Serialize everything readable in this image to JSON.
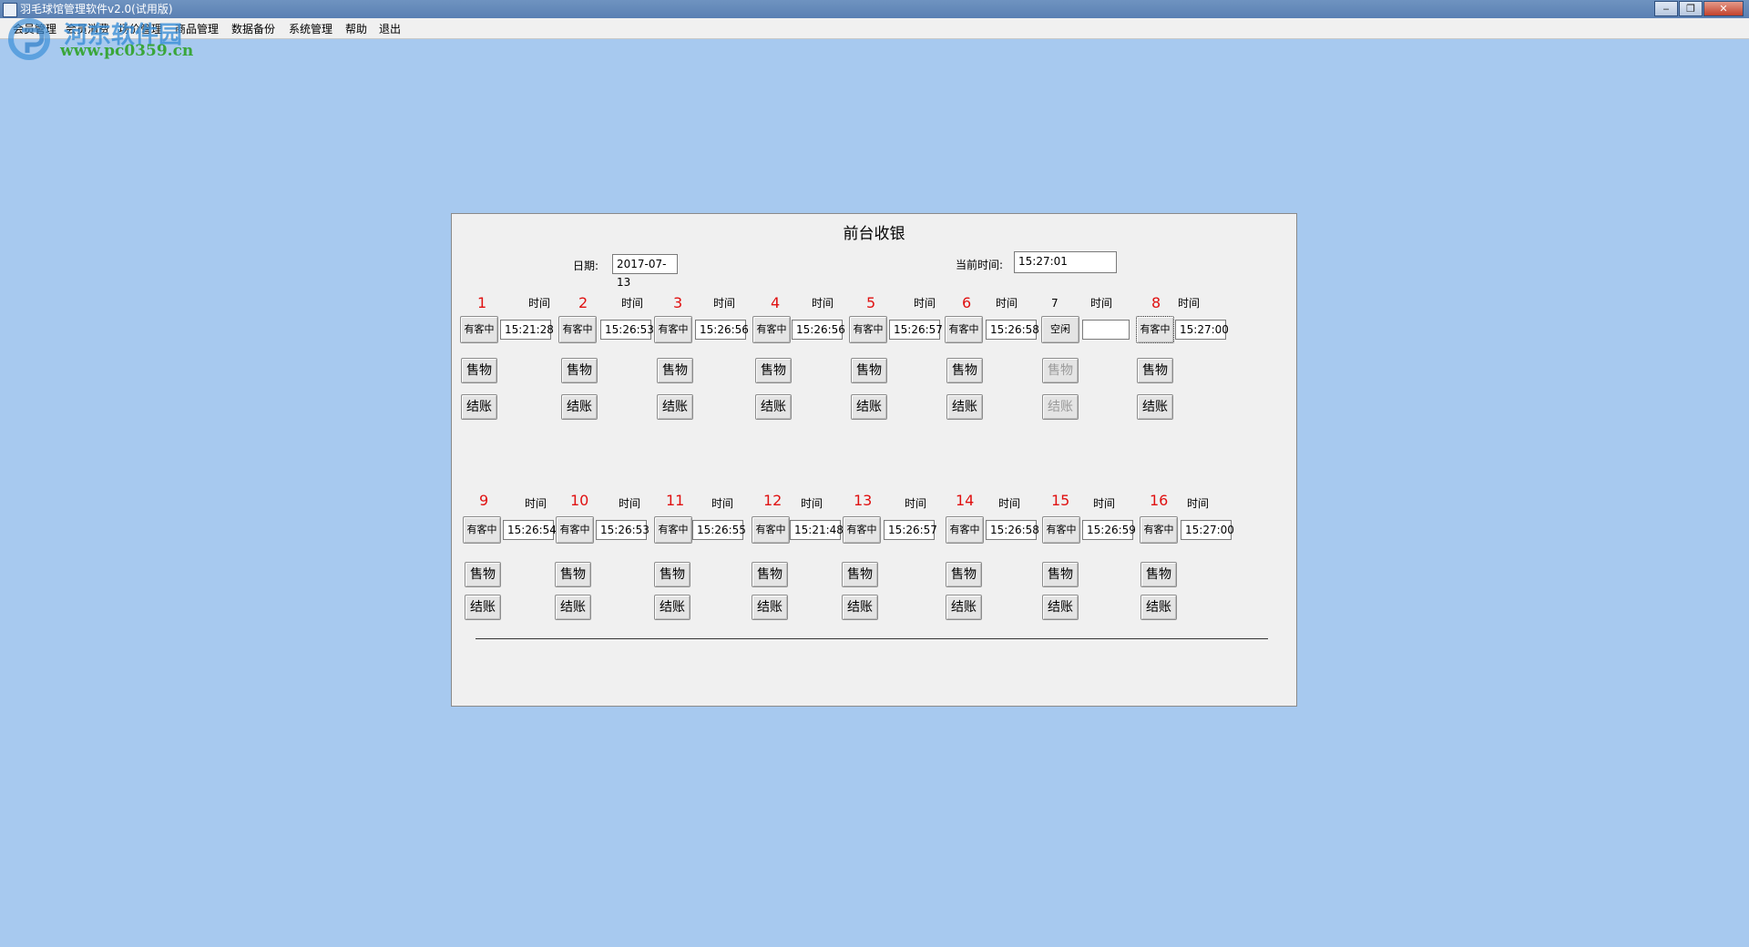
{
  "window": {
    "title": "羽毛球馆管理软件v2.0(试用版)",
    "controls": [
      "‒",
      "❐",
      "✕"
    ]
  },
  "menu": [
    "会员管理",
    "会员消费",
    "场价管理",
    "商品管理",
    "数据备份",
    "系统管理",
    "帮助",
    "退出"
  ],
  "watermark": {
    "site_name": "河东软件园",
    "url": "www.pc0359.cn"
  },
  "panel": {
    "title": "前台收银",
    "date_label": "日期:",
    "date_value": "2017-07-13",
    "current_time_label": "当前时间:",
    "current_time_value": "15:27:01",
    "time_label": "时间",
    "sell_label": "售物",
    "checkout_label": "结账"
  },
  "courts": [
    {
      "number": "1",
      "status": "有客中",
      "time": "15:21:28",
      "idle": false
    },
    {
      "number": "2",
      "status": "有客中",
      "time": "15:26:53",
      "idle": false
    },
    {
      "number": "3",
      "status": "有客中",
      "time": "15:26:56",
      "idle": false
    },
    {
      "number": "4",
      "status": "有客中",
      "time": "15:26:56",
      "idle": false
    },
    {
      "number": "5",
      "status": "有客中",
      "time": "15:26:57",
      "idle": false
    },
    {
      "number": "6",
      "status": "有客中",
      "time": "15:26:58",
      "idle": false
    },
    {
      "number": "7",
      "status": "空闲",
      "time": "",
      "idle": true
    },
    {
      "number": "8",
      "status": "有客中",
      "time": "15:27:00",
      "idle": false
    },
    {
      "number": "9",
      "status": "有客中",
      "time": "15:26:54",
      "idle": false
    },
    {
      "number": "10",
      "status": "有客中",
      "time": "15:26:53",
      "idle": false
    },
    {
      "number": "11",
      "status": "有客中",
      "time": "15:26:55",
      "idle": false
    },
    {
      "number": "12",
      "status": "有客中",
      "time": "15:21:48",
      "idle": false
    },
    {
      "number": "13",
      "status": "有客中",
      "time": "15:26:57",
      "idle": false
    },
    {
      "number": "14",
      "status": "有客中",
      "time": "15:26:58",
      "idle": false
    },
    {
      "number": "15",
      "status": "有客中",
      "time": "15:26:59",
      "idle": false
    },
    {
      "number": "16",
      "status": "有客中",
      "time": "15:27:00",
      "idle": false
    }
  ],
  "colors": {
    "desktop": "#a7c9ef",
    "panel": "#f0f0f0",
    "court_number": "#e01010"
  }
}
